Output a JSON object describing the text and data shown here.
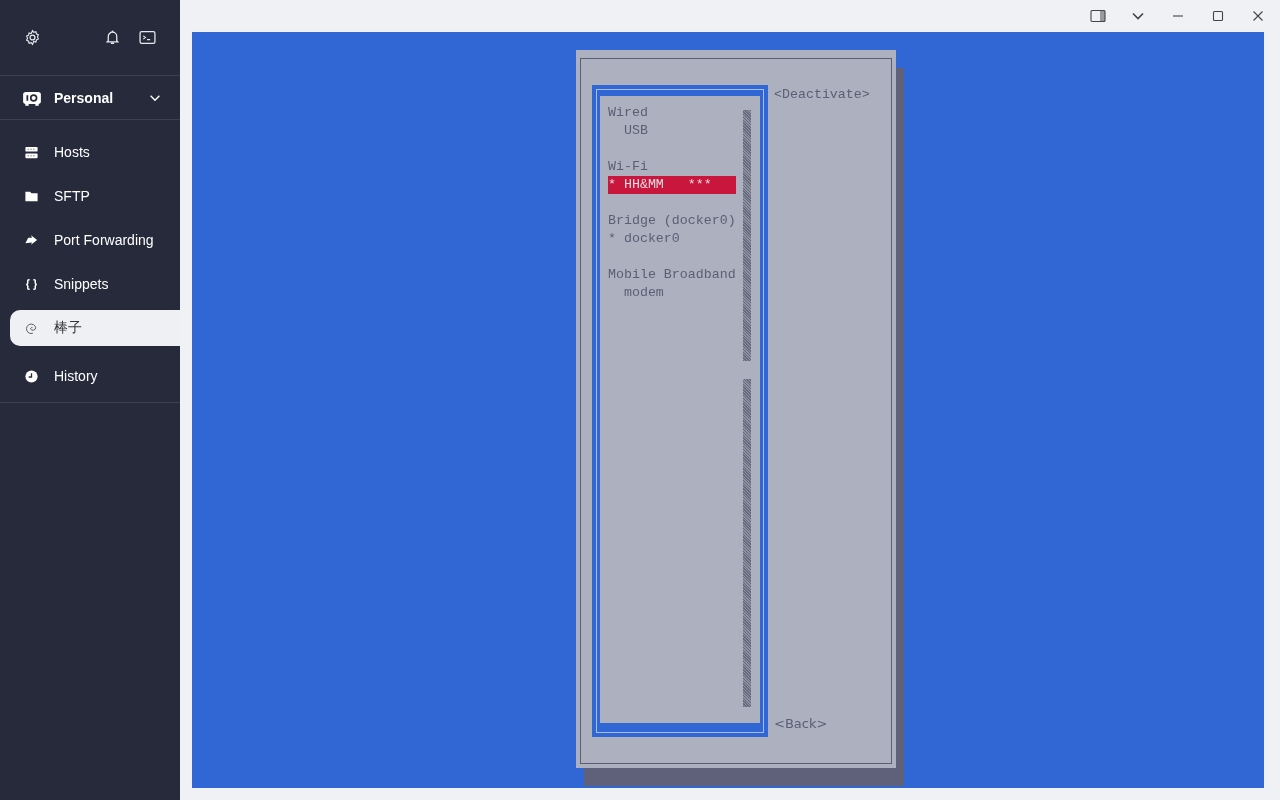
{
  "sidebar": {
    "profile": {
      "label": "Personal",
      "expanded": false
    },
    "items": [
      {
        "label": "Hosts",
        "selected": false
      },
      {
        "label": "SFTP",
        "selected": false
      },
      {
        "label": "Port Forwarding",
        "selected": false
      },
      {
        "label": "Snippets",
        "selected": false
      },
      {
        "label": "棒子",
        "selected": true
      },
      {
        "label": "History",
        "selected": false
      }
    ]
  },
  "terminal": {
    "sections": [
      {
        "title": "Wired",
        "items": [
          {
            "label": "USB",
            "selected": false
          }
        ]
      },
      {
        "title": "Wi-Fi",
        "items": [
          {
            "marker": "*",
            "label": "HH&MM",
            "signal": "***",
            "selected": true
          }
        ]
      },
      {
        "title": "Bridge (docker0)",
        "items": [
          {
            "marker": "*",
            "label": "docker0",
            "selected": false
          }
        ]
      },
      {
        "title": "Mobile Broadband",
        "items": [
          {
            "label": "modem",
            "selected": false
          }
        ]
      }
    ],
    "buttons": [
      {
        "label": "<Deactivate>",
        "kind": "top"
      },
      {
        "label": "<Back>",
        "kind": "bottom"
      }
    ]
  }
}
